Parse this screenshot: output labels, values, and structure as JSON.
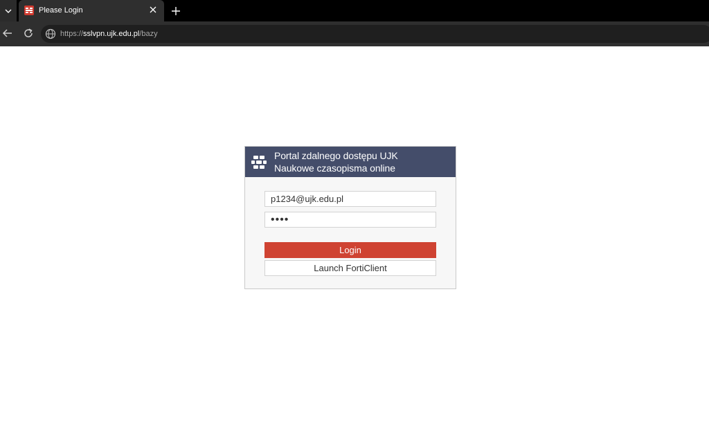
{
  "browser": {
    "tab": {
      "title": "Please Login",
      "favicon": "fortinet-icon"
    },
    "address": {
      "scheme": "https://",
      "host": "sslvpn.ujk.edu.pl",
      "path": "/bazy"
    },
    "icons": [
      "tab-search-icon",
      "close-icon",
      "new-tab-icon",
      "back-icon",
      "reload-icon",
      "site-info-icon"
    ]
  },
  "login": {
    "title_line1": "Portal zdalnego dostępu UJK",
    "title_line2": "Naukowe czasopisma online",
    "username_value": "p1234@ujk.edu.pl",
    "password_value": "••••",
    "login_label": "Login",
    "forticlient_label": "Launch FortiClient"
  },
  "colors": {
    "header_bg": "#444d6a",
    "login_button": "#cf4332",
    "panel_bg": "#f7f7f7"
  }
}
